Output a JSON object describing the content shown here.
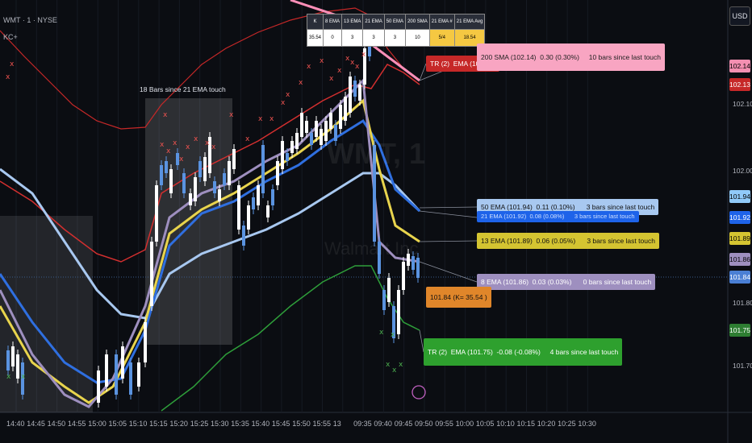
{
  "header": {
    "symbol": "WMT · 1 · NYSE",
    "indicator": "KC+"
  },
  "currency_button": "USD",
  "watermark": {
    "symbol": "WMT, 1",
    "name": "Walmart Inc"
  },
  "annotation": "18  Bars since 21 EMA touch",
  "stats_table": {
    "headers": [
      "K",
      "8 EMA",
      "13 EMA",
      "21 EMA",
      "50 EMA",
      "200 SMA",
      "21 EMA #",
      "21 EMA Avg"
    ],
    "values": [
      "35.54",
      "0",
      "3",
      "3",
      "3",
      "10",
      "5/4",
      "18.54"
    ]
  },
  "price_badges": [
    {
      "label": "102.14",
      "bg": "#f48fb1",
      "fg": "#000000"
    },
    {
      "label": "102.13",
      "bg": "#c62828",
      "fg": "#ffffff"
    },
    {
      "label": "101.94",
      "bg": "#90caf9",
      "fg": "#000000"
    },
    {
      "label": "101.92",
      "bg": "#1e63e9",
      "fg": "#ffffff"
    },
    {
      "label": "101.89",
      "bg": "#d4c431",
      "fg": "#000000"
    },
    {
      "label": "101.86",
      "bg": "#9e8fbf",
      "fg": "#000000"
    },
    {
      "label": "101.84",
      "bg": "#4a7fd4",
      "fg": "#ffffff"
    },
    {
      "label": "101.75",
      "bg": "#2e7d32",
      "fg": "#ffffff"
    }
  ],
  "price_axis": [
    "102.10",
    "102.00",
    "101.80",
    "101.70"
  ],
  "time_axis": [
    "14:40",
    "14:45",
    "14:50",
    "14:55",
    "15:00",
    "15:05",
    "15:10",
    "15:15",
    "15:20",
    "15:25",
    "15:30",
    "15:35",
    "15:40",
    "15:45",
    "15:50",
    "15:55",
    "13",
    "09:35",
    "09:40",
    "09:45",
    "09:50",
    "09:55",
    "10:00",
    "10:05",
    "10:10",
    "10:15",
    "10:20",
    "10:25",
    "10:30"
  ],
  "tags": {
    "upper_tr": "TR (2)  EMA (102.13)",
    "sma200": "200 SMA (102.14)  0.30 (0.30%)     10 bars since last touch",
    "ema50": "50 EMA (101.94)  0.11 (0.10%)      3 bars since last touch",
    "ema21": "21 EMA (101.92)  0.08 (0.08%)      3 bars since last touch",
    "ema13": "13 EMA (101.89)  0.06 (0.05%)      3 bars since last touch",
    "ema8": "8 EMA (101.86)  0.03 (0.03%)      0 bars since last touch",
    "price": "101.84 (K= 35.54 )",
    "lower_tr": "TR (2)  EMA (101.75)  -0.08 (-0.08%)     4 bars since last touch"
  },
  "colors": {
    "background": "#0b0d12",
    "candle_up": "#ffffff",
    "candle_down": "#5a93e0",
    "upper_band": "#c62828",
    "lower_band": "#2e9e3a",
    "ema8": "#9e8fbf",
    "ema13": "#e8d44d",
    "ema21": "#2f6fe0",
    "ema50": "#a8c8f0",
    "sma200": "#ff8fb8"
  }
}
